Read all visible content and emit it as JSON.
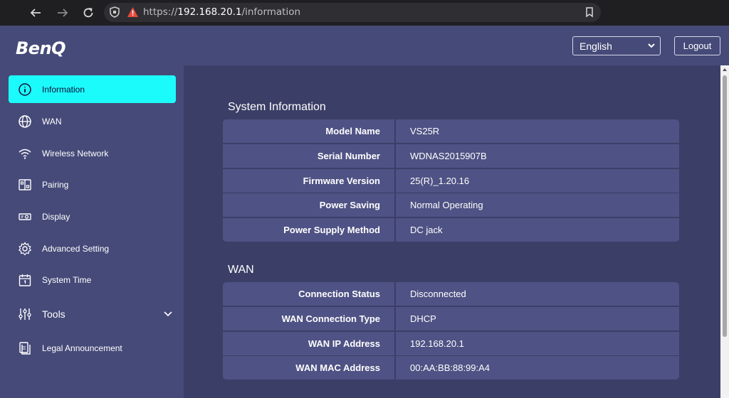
{
  "browser": {
    "url_scheme": "https://",
    "url_host": "192.168.20.1",
    "url_path": "/information"
  },
  "header": {
    "logo": "BenQ",
    "language_selected": "English",
    "logout_label": "Logout"
  },
  "sidebar": {
    "items": [
      {
        "label": "Information",
        "icon": "info-icon",
        "active": true
      },
      {
        "label": "WAN",
        "icon": "globe-icon"
      },
      {
        "label": "Wireless Network",
        "icon": "wifi-icon"
      },
      {
        "label": "Pairing",
        "icon": "pairing-icon"
      },
      {
        "label": "Display",
        "icon": "display-icon"
      },
      {
        "label": "Advanced Setting",
        "icon": "gear-icon"
      },
      {
        "label": "System Time",
        "icon": "calendar-icon"
      },
      {
        "label": "Tools",
        "icon": "sliders-icon",
        "expandable": true
      },
      {
        "label": "Legal Announcement",
        "icon": "document-icon"
      }
    ]
  },
  "system_information": {
    "title": "System Information",
    "rows": [
      {
        "label": "Model Name",
        "value": "VS25R"
      },
      {
        "label": "Serial Number",
        "value": "WDNAS2015907B"
      },
      {
        "label": "Firmware Version",
        "value": "25(R)_1.20.16"
      },
      {
        "label": "Power Saving",
        "value": "Normal Operating"
      },
      {
        "label": "Power Supply Method",
        "value": "DC jack"
      }
    ]
  },
  "wan": {
    "title": "WAN",
    "rows": [
      {
        "label": "Connection Status",
        "value": "Disconnected"
      },
      {
        "label": "WAN Connection Type",
        "value": "DHCP"
      },
      {
        "label": "WAN IP Address",
        "value": "192.168.20.1"
      },
      {
        "label": "WAN MAC Address",
        "value": "00:AA:BB:88:99:A4"
      }
    ]
  },
  "colors": {
    "active_item": "#1cfbfb",
    "header_bg": "#464a78",
    "content_bg": "#3b3e66",
    "row_bg": "#4f5284"
  }
}
